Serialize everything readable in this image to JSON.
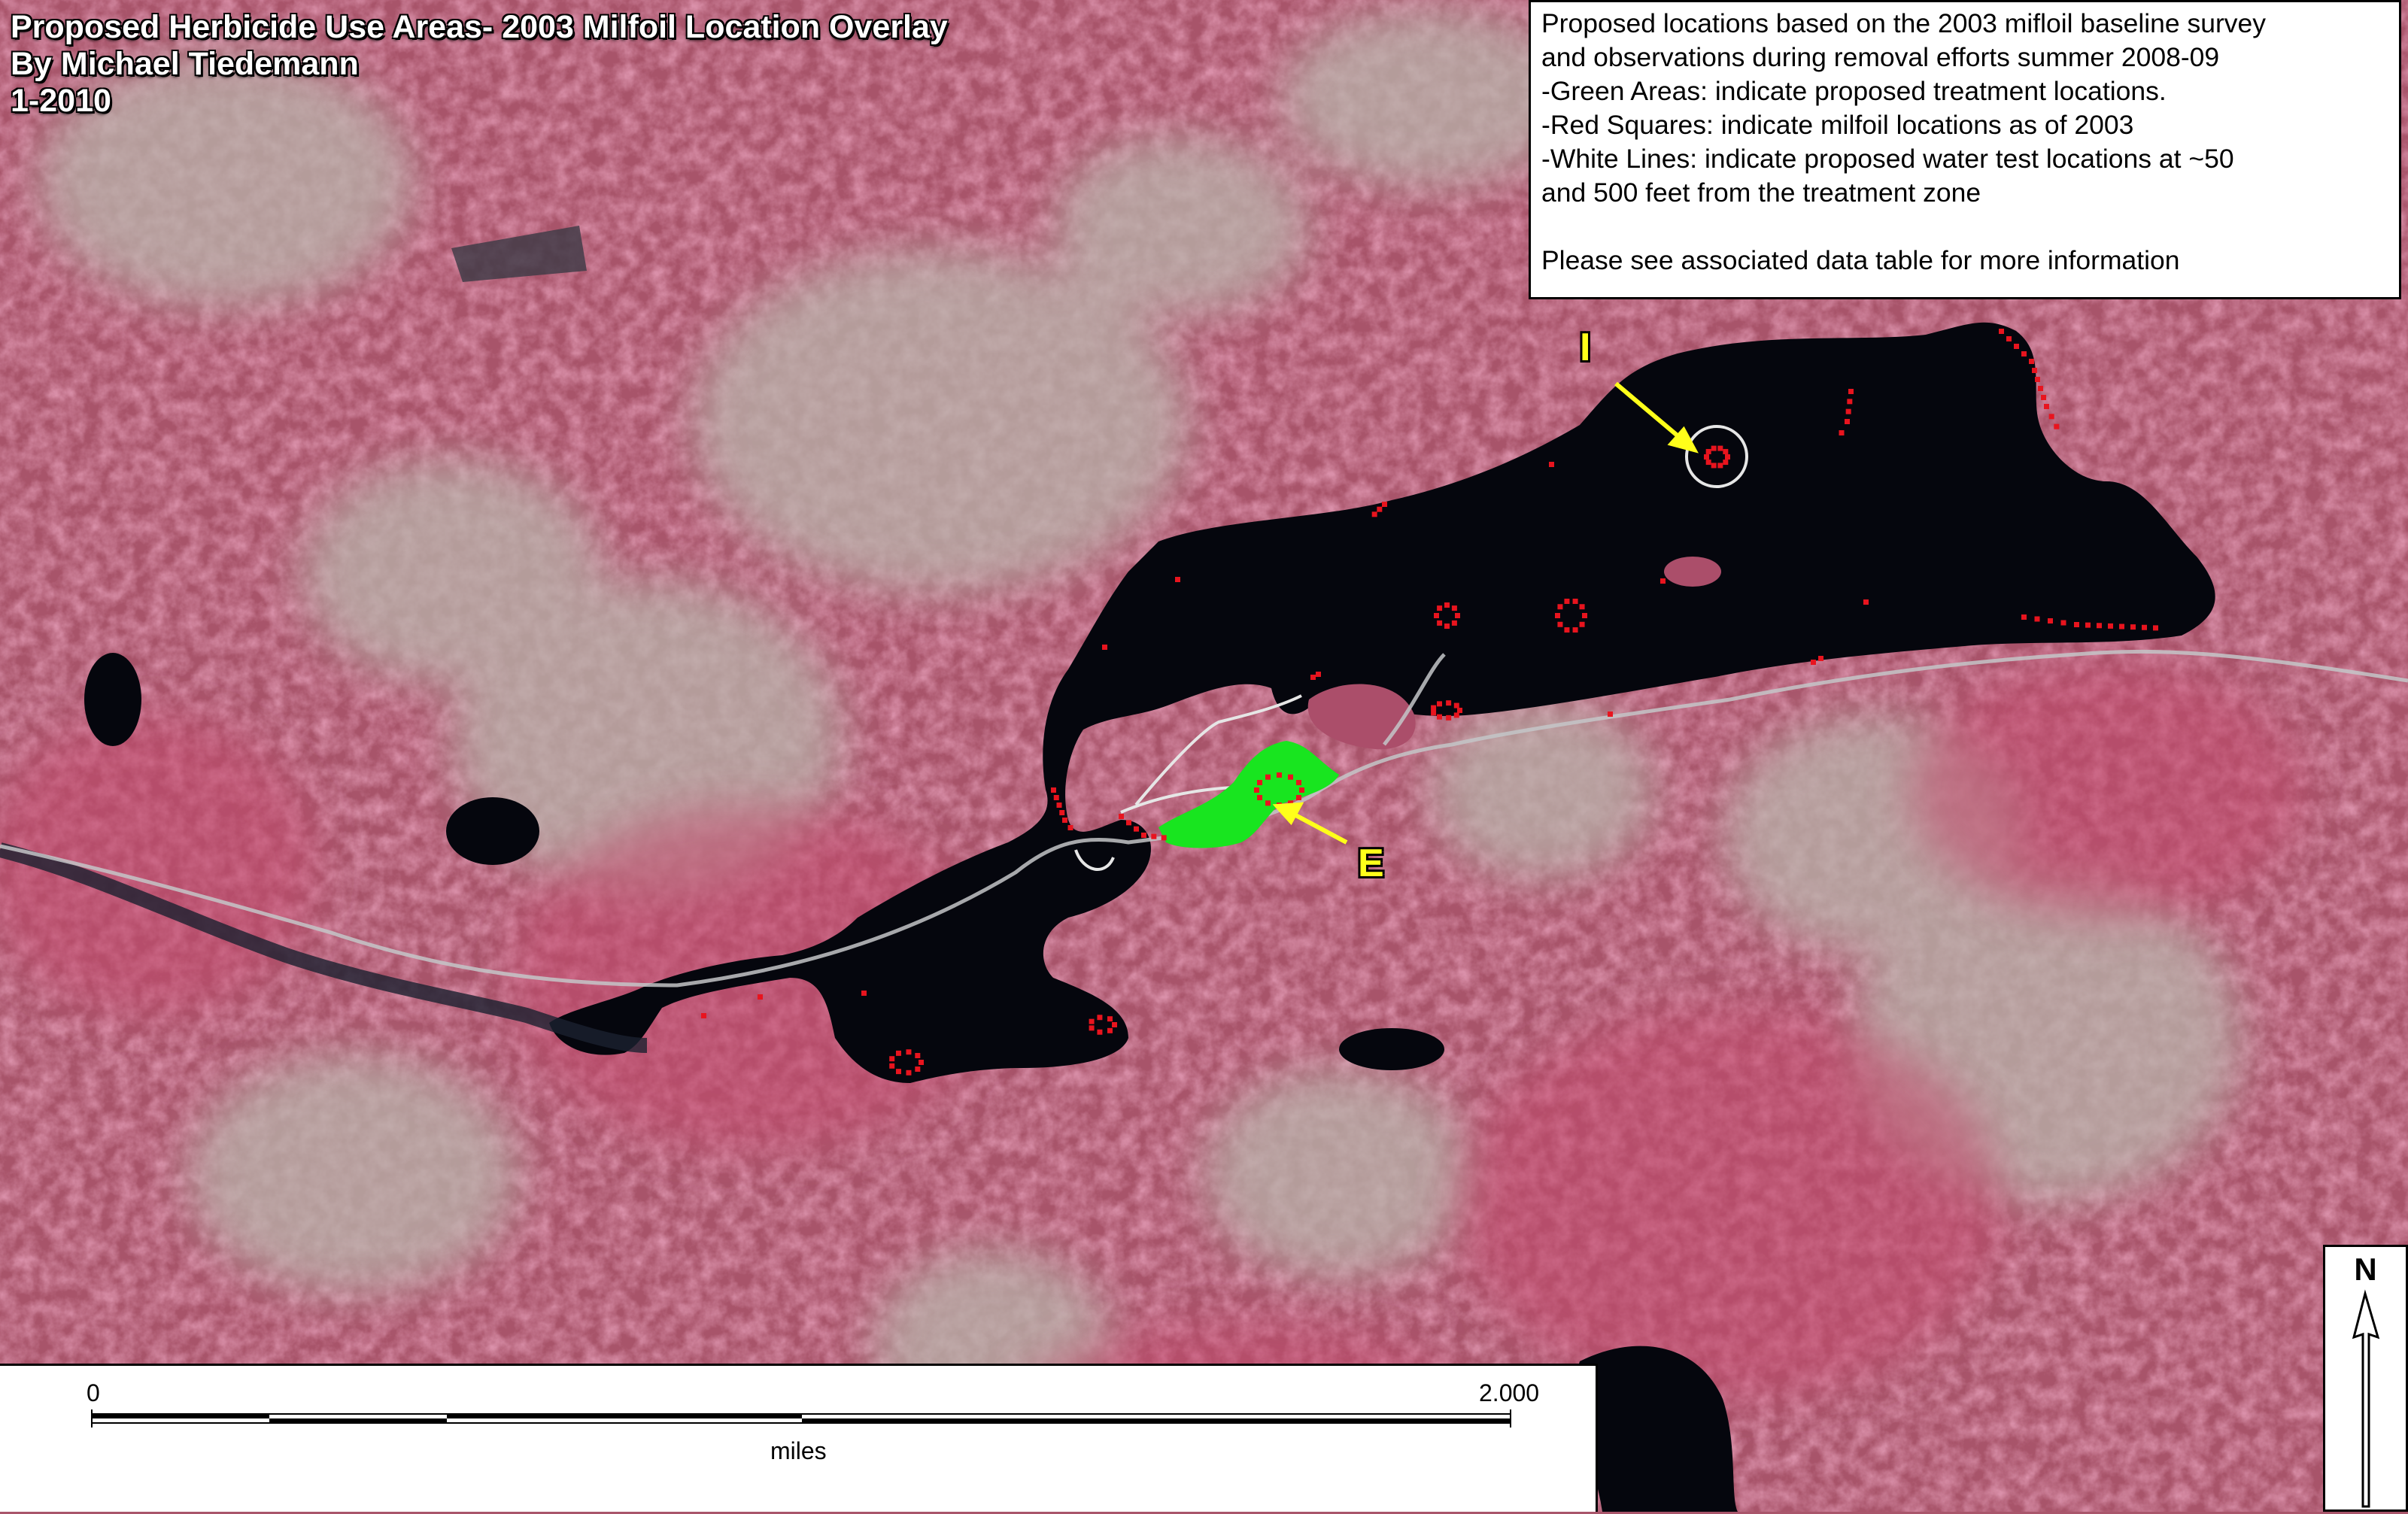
{
  "map": {
    "title_lines": [
      "Proposed Herbicide Use Areas- 2003 Milfoil Location Overlay",
      "By Michael Tiedemann",
      "1-2010"
    ],
    "basemap": "color-infrared aerial photograph",
    "colors": {
      "vegetation": "#b04a66",
      "bare_ground": "#b7b3aa",
      "water": "#05060d",
      "treatment_area": "#18e51f",
      "milfoil_marker": "#e8141e",
      "test_lines": "#e6e6e6",
      "label_text": "#ffff1a",
      "label_arrow": "#ffff1a"
    }
  },
  "legend": {
    "lines": [
      "Proposed locations based on the 2003 mifloil baseline survey",
      "and observations during removal efforts summer 2008-09",
      "-Green Areas: indicate proposed treatment locations.",
      "-Red Squares: indicate milfoil locations as of 2003",
      "-White Lines: indicate proposed water test locations at ~50",
      "and 500 feet from the treatment zone"
    ],
    "footer": "Please see associated data table for more information"
  },
  "scale_bar": {
    "start_label": "0",
    "end_label": "2.000",
    "unit_label": "miles"
  },
  "north_arrow": {
    "label": "N",
    "icon": "north-arrow-icon"
  },
  "site_labels": [
    {
      "id": "I",
      "text": "I"
    },
    {
      "id": "E",
      "text": "E"
    }
  ]
}
